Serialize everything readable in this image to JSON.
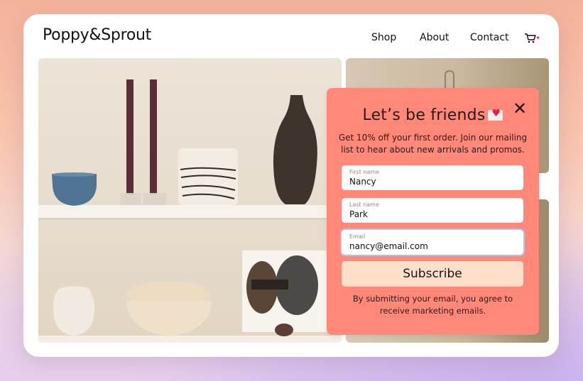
{
  "header": {
    "logo": "Poppy&Sprout",
    "nav": [
      {
        "label": "Shop"
      },
      {
        "label": "About"
      },
      {
        "label": "Contact"
      }
    ],
    "cart_icon": "shopping-cart-icon",
    "cart_badge_color": "#e0246a"
  },
  "gallery": {
    "main_image": "shelves-with-ceramics-and-candles",
    "top_right_image": "wall-hook-photo",
    "bottom_right_image": "interior-photo"
  },
  "popup": {
    "title": "Let’s be friends",
    "title_icon": "love-letter-icon",
    "subtitle": "Get 10% off your first order. Join our mailing list to hear about new arrivals and promos.",
    "close_icon": "close-icon",
    "fields": [
      {
        "label": "First name",
        "value": "Nancy"
      },
      {
        "label": "Last name",
        "value": "Park"
      },
      {
        "label": "Email",
        "value": "nancy@email.com"
      }
    ],
    "subscribe_label": "Subscribe",
    "disclaimer": "By submitting your email, you agree to receive marketing emails.",
    "background_color": "#ff8878",
    "button_color": "#ffdfca"
  }
}
